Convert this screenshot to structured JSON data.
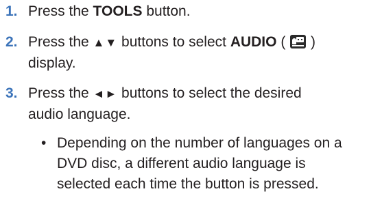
{
  "steps": [
    {
      "number": "1.",
      "pre": "Press the ",
      "bold": "TOOLS",
      "post": " button."
    },
    {
      "number": "2.",
      "pre": "Press the ",
      "arrows": "▲▼",
      "mid": " buttons to select ",
      "bold": "AUDIO",
      "open_paren": " ( ",
      "icon": "audio-display-icon",
      "close_paren": " )",
      "line2": "display."
    },
    {
      "number": "3.",
      "pre": "Press the ",
      "arrows": "◄►",
      "mid": " buttons to select the desired",
      "line2": "audio language."
    }
  ],
  "bullet": {
    "dot": "•",
    "lines": [
      "Depending on the number of languages on a",
      "DVD disc, a different audio language is",
      "selected each time the button is pressed."
    ]
  },
  "colors": {
    "step_number": "#3b73b9",
    "text": "#231f20"
  }
}
